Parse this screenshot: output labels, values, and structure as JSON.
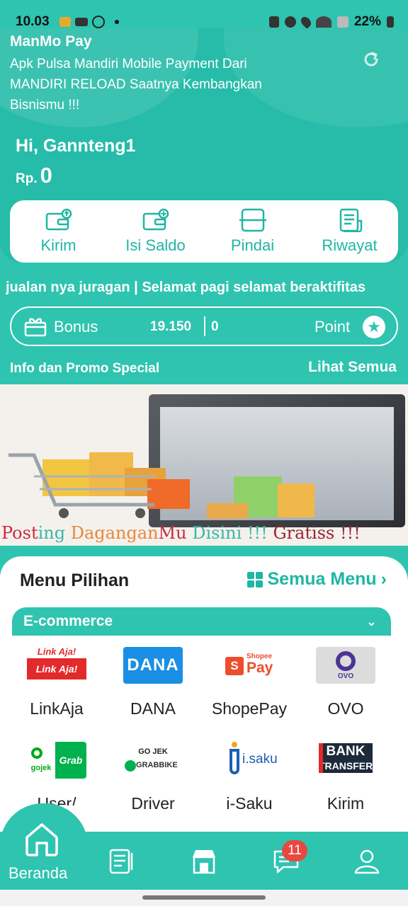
{
  "status_bar": {
    "time": "10.03",
    "battery": "22%"
  },
  "header": {
    "app_name": "ManMo Pay",
    "tagline": "Apk Pulsa Mandiri Mobile Payment Dari MANDIRI RELOAD Saatnya Kembangkan Bisnismu !!!",
    "greeting": "Hi, Gannteng1",
    "currency": "Rp.",
    "balance": "0"
  },
  "actions": [
    {
      "label": "Kirim",
      "icon": "send-wallet-icon"
    },
    {
      "label": "Isi Saldo",
      "icon": "topup-wallet-icon"
    },
    {
      "label": "Pindai",
      "icon": "scan-icon"
    },
    {
      "label": "Riwayat",
      "icon": "history-icon"
    }
  ],
  "marquee": "jualan nya juragan  | Selamat pagi selamat beraktifitas",
  "bonus": {
    "bonus_label": "Bonus",
    "bonus_value": "19.150",
    "point_value": "0",
    "point_label": "Point"
  },
  "promo": {
    "title": "Info dan Promo Special",
    "see_all": "Lihat Semua"
  },
  "banner": {
    "text_parts": [
      "Post",
      "ing ",
      "Dagangan",
      "Mu ",
      "Disini !!! ",
      "Gratiss !!!"
    ]
  },
  "menu": {
    "title": "Menu Pilihan",
    "see_all": "Semua Menu",
    "category": "E-commerce",
    "items": [
      {
        "label": "LinkAja",
        "icon": "linkaja-logo",
        "logo_text_top": "Link Aja!",
        "logo_text_bottom": "Link Aja!"
      },
      {
        "label": "DANA",
        "icon": "dana-logo",
        "logo_text": "DANA"
      },
      {
        "label": "ShopePay",
        "icon": "shopeepay-logo",
        "logo_text": "Pay",
        "logo_sub": "Shopee"
      },
      {
        "label": "OVO",
        "icon": "ovo-logo",
        "logo_text": "OVO"
      },
      {
        "label": "User/",
        "icon": "gojek-grab-logo",
        "logo_text_left": "gojek",
        "logo_text_right": "Grab"
      },
      {
        "label": "Driver",
        "icon": "gojek-grabbike-logo",
        "logo_text_top": "GO JEK",
        "logo_text_bottom": "GRABBIKE"
      },
      {
        "label": "i-Saku",
        "icon": "isaku-logo",
        "logo_text": "i.saku"
      },
      {
        "label": "Kirim",
        "icon": "bank-transfer-logo",
        "logo_text_top": "BANK",
        "logo_text_bottom": "TRANSFER"
      }
    ]
  },
  "bottom_nav": {
    "home_label": "Beranda",
    "chat_badge": "11",
    "items": [
      "home-icon",
      "transactions-icon",
      "store-icon",
      "chat-icon",
      "profile-icon"
    ]
  },
  "colors": {
    "primary": "#2ec4b0",
    "accent": "#1fb6a3",
    "badge": "#e8483f"
  }
}
